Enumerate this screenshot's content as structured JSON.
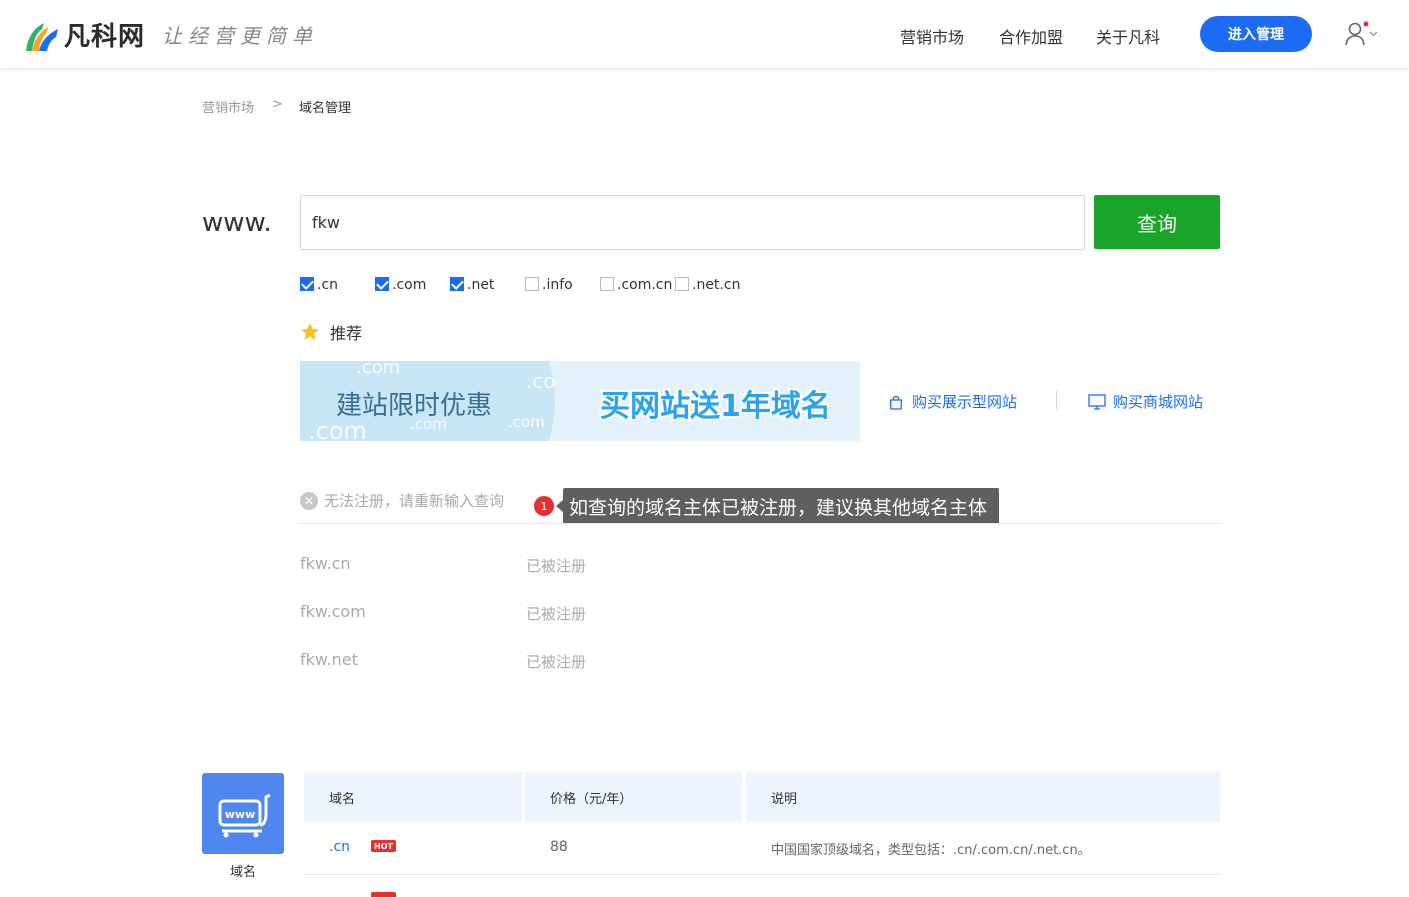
{
  "header": {
    "logo_text": "凡科网",
    "slogan": "让经营更简单",
    "nav": [
      "营销市场",
      "合作加盟",
      "关于凡科"
    ],
    "manage_button": "进入管理"
  },
  "breadcrumb": {
    "parent": "营销市场",
    "separator": ">",
    "current": "域名管理"
  },
  "search": {
    "prefix": "www.",
    "value": "fkw",
    "button": "查询",
    "tlds": [
      {
        "label": ".cn",
        "checked": true
      },
      {
        "label": ".com",
        "checked": true
      },
      {
        "label": ".net",
        "checked": true
      },
      {
        "label": ".info",
        "checked": false
      },
      {
        "label": ".com.cn",
        "checked": false
      },
      {
        "label": ".net.cn",
        "checked": false
      }
    ]
  },
  "recommend": {
    "label": "推荐",
    "banner_left": "建站限时优惠",
    "banner_right": "买网站送1年域名",
    "links": [
      "购买展示型网站",
      "购买商城网站"
    ]
  },
  "result": {
    "error": "无法注册，请重新输入查询",
    "badge": "1",
    "tooltip": "如查询的域名主体已被注册，建议换其他域名主体",
    "rows": [
      {
        "domain": "fkw.cn",
        "status": "已被注册"
      },
      {
        "domain": "fkw.com",
        "status": "已被注册"
      },
      {
        "domain": "fkw.net",
        "status": "已被注册"
      }
    ]
  },
  "price_table": {
    "icon_label": "域名",
    "headers": [
      "域名",
      "价格（元/年）",
      "说明"
    ],
    "rows": [
      {
        "tld": ".cn",
        "hot": "HOT",
        "price": "88",
        "desc": "中国国家顶级域名，类型包括：.cn/.com.cn/.net.cn。"
      }
    ]
  },
  "colors": {
    "accent": "#1b6cf2",
    "search_button": "#1aa42a",
    "badge": "#e53030"
  }
}
